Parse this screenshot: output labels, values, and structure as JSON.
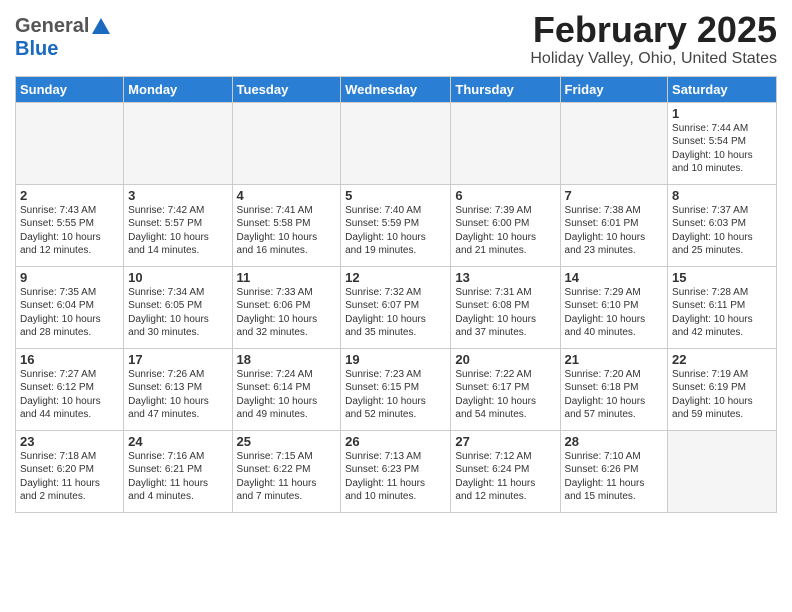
{
  "header": {
    "logo_general": "General",
    "logo_blue": "Blue",
    "month_title": "February 2025",
    "location": "Holiday Valley, Ohio, United States"
  },
  "days_of_week": [
    "Sunday",
    "Monday",
    "Tuesday",
    "Wednesday",
    "Thursday",
    "Friday",
    "Saturday"
  ],
  "weeks": [
    [
      {
        "day": "",
        "info": ""
      },
      {
        "day": "",
        "info": ""
      },
      {
        "day": "",
        "info": ""
      },
      {
        "day": "",
        "info": ""
      },
      {
        "day": "",
        "info": ""
      },
      {
        "day": "",
        "info": ""
      },
      {
        "day": "1",
        "info": "Sunrise: 7:44 AM\nSunset: 5:54 PM\nDaylight: 10 hours\nand 10 minutes."
      }
    ],
    [
      {
        "day": "2",
        "info": "Sunrise: 7:43 AM\nSunset: 5:55 PM\nDaylight: 10 hours\nand 12 minutes."
      },
      {
        "day": "3",
        "info": "Sunrise: 7:42 AM\nSunset: 5:57 PM\nDaylight: 10 hours\nand 14 minutes."
      },
      {
        "day": "4",
        "info": "Sunrise: 7:41 AM\nSunset: 5:58 PM\nDaylight: 10 hours\nand 16 minutes."
      },
      {
        "day": "5",
        "info": "Sunrise: 7:40 AM\nSunset: 5:59 PM\nDaylight: 10 hours\nand 19 minutes."
      },
      {
        "day": "6",
        "info": "Sunrise: 7:39 AM\nSunset: 6:00 PM\nDaylight: 10 hours\nand 21 minutes."
      },
      {
        "day": "7",
        "info": "Sunrise: 7:38 AM\nSunset: 6:01 PM\nDaylight: 10 hours\nand 23 minutes."
      },
      {
        "day": "8",
        "info": "Sunrise: 7:37 AM\nSunset: 6:03 PM\nDaylight: 10 hours\nand 25 minutes."
      }
    ],
    [
      {
        "day": "9",
        "info": "Sunrise: 7:35 AM\nSunset: 6:04 PM\nDaylight: 10 hours\nand 28 minutes."
      },
      {
        "day": "10",
        "info": "Sunrise: 7:34 AM\nSunset: 6:05 PM\nDaylight: 10 hours\nand 30 minutes."
      },
      {
        "day": "11",
        "info": "Sunrise: 7:33 AM\nSunset: 6:06 PM\nDaylight: 10 hours\nand 32 minutes."
      },
      {
        "day": "12",
        "info": "Sunrise: 7:32 AM\nSunset: 6:07 PM\nDaylight: 10 hours\nand 35 minutes."
      },
      {
        "day": "13",
        "info": "Sunrise: 7:31 AM\nSunset: 6:08 PM\nDaylight: 10 hours\nand 37 minutes."
      },
      {
        "day": "14",
        "info": "Sunrise: 7:29 AM\nSunset: 6:10 PM\nDaylight: 10 hours\nand 40 minutes."
      },
      {
        "day": "15",
        "info": "Sunrise: 7:28 AM\nSunset: 6:11 PM\nDaylight: 10 hours\nand 42 minutes."
      }
    ],
    [
      {
        "day": "16",
        "info": "Sunrise: 7:27 AM\nSunset: 6:12 PM\nDaylight: 10 hours\nand 44 minutes."
      },
      {
        "day": "17",
        "info": "Sunrise: 7:26 AM\nSunset: 6:13 PM\nDaylight: 10 hours\nand 47 minutes."
      },
      {
        "day": "18",
        "info": "Sunrise: 7:24 AM\nSunset: 6:14 PM\nDaylight: 10 hours\nand 49 minutes."
      },
      {
        "day": "19",
        "info": "Sunrise: 7:23 AM\nSunset: 6:15 PM\nDaylight: 10 hours\nand 52 minutes."
      },
      {
        "day": "20",
        "info": "Sunrise: 7:22 AM\nSunset: 6:17 PM\nDaylight: 10 hours\nand 54 minutes."
      },
      {
        "day": "21",
        "info": "Sunrise: 7:20 AM\nSunset: 6:18 PM\nDaylight: 10 hours\nand 57 minutes."
      },
      {
        "day": "22",
        "info": "Sunrise: 7:19 AM\nSunset: 6:19 PM\nDaylight: 10 hours\nand 59 minutes."
      }
    ],
    [
      {
        "day": "23",
        "info": "Sunrise: 7:18 AM\nSunset: 6:20 PM\nDaylight: 11 hours\nand 2 minutes."
      },
      {
        "day": "24",
        "info": "Sunrise: 7:16 AM\nSunset: 6:21 PM\nDaylight: 11 hours\nand 4 minutes."
      },
      {
        "day": "25",
        "info": "Sunrise: 7:15 AM\nSunset: 6:22 PM\nDaylight: 11 hours\nand 7 minutes."
      },
      {
        "day": "26",
        "info": "Sunrise: 7:13 AM\nSunset: 6:23 PM\nDaylight: 11 hours\nand 10 minutes."
      },
      {
        "day": "27",
        "info": "Sunrise: 7:12 AM\nSunset: 6:24 PM\nDaylight: 11 hours\nand 12 minutes."
      },
      {
        "day": "28",
        "info": "Sunrise: 7:10 AM\nSunset: 6:26 PM\nDaylight: 11 hours\nand 15 minutes."
      },
      {
        "day": "",
        "info": ""
      }
    ]
  ]
}
